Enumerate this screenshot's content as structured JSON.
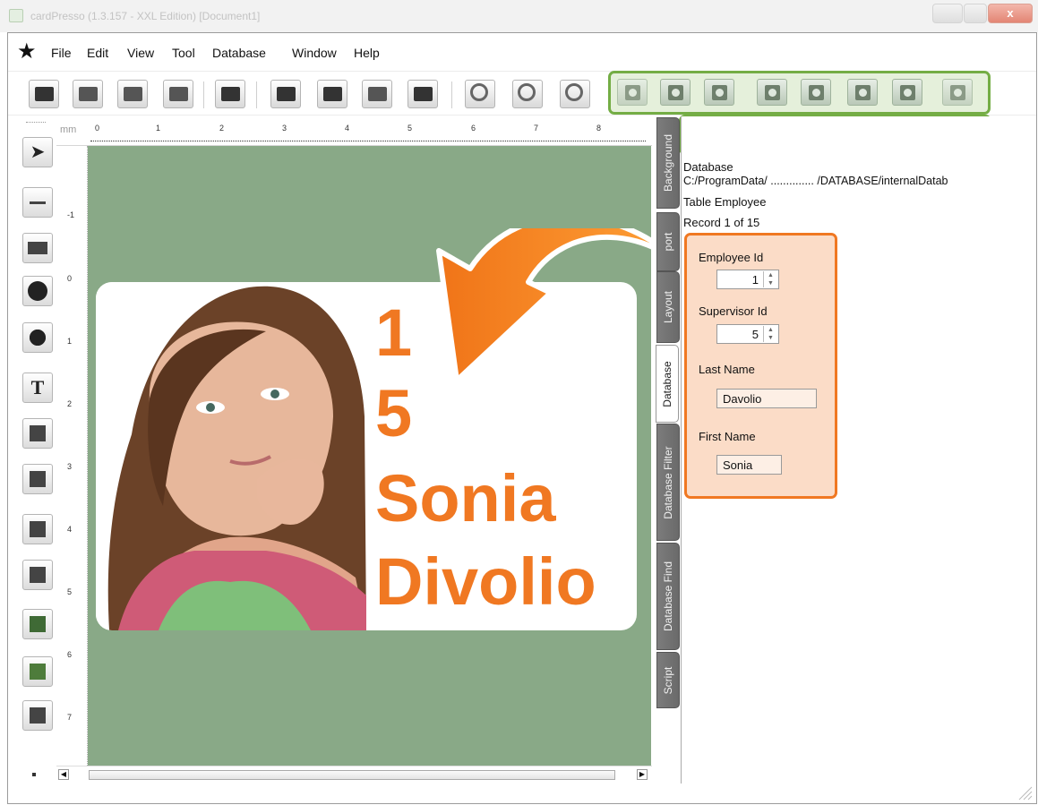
{
  "window": {
    "title": "cardPresso (1.3.157 - XXL Edition) [Document1]",
    "close_glyph": "x"
  },
  "menu": [
    "File",
    "Edit",
    "View",
    "Tool",
    "Database",
    "Window",
    "Help"
  ],
  "ruler": {
    "unit": "mm",
    "top_numbers": [
      "0",
      "1",
      "2",
      "3",
      "4",
      "5",
      "6",
      "7",
      "8"
    ],
    "left_numbers": [
      "-1",
      "0",
      "1",
      "2",
      "3",
      "4",
      "5",
      "6",
      "7"
    ]
  },
  "card": {
    "line1": "1",
    "line2": "5",
    "line3": "Sonia",
    "line4": "Divolio"
  },
  "tabs": [
    "Background",
    "Layout / Export",
    "Layout",
    "Database",
    "Database Filter",
    "Database Find",
    "Script"
  ],
  "tab_labels_visible": [
    "Background",
    "port",
    "Layout",
    "Database",
    "Database Filter",
    "Database Find",
    "Script"
  ],
  "database": {
    "heading": "Database",
    "path": "C:/ProgramData/ .............. /DATABASE/internalDatab",
    "table": "Table Employee",
    "record": "Record 1 of 15"
  },
  "fields": {
    "employee_id_label": "Employee Id",
    "employee_id_value": "1",
    "supervisor_id_label": "Supervisor Id",
    "supervisor_id_value": "5",
    "last_name_label": "Last Name",
    "last_name_value": "Davolio",
    "first_name_label": "First Name",
    "first_name_value": "Sonia"
  },
  "colors": {
    "accent_orange": "#f07822",
    "nav_green": "#74ad45",
    "canvas_green": "#89a987"
  },
  "icons": [
    "star-icon",
    "pointer-icon",
    "line-icon",
    "rectangle-icon",
    "ellipse-icon",
    "shape-icon",
    "text-icon",
    "counter-icon",
    "calendar-icon",
    "barcode-icon",
    "qrcode-icon",
    "image-icon",
    "picture-icon",
    "camera-icon"
  ]
}
